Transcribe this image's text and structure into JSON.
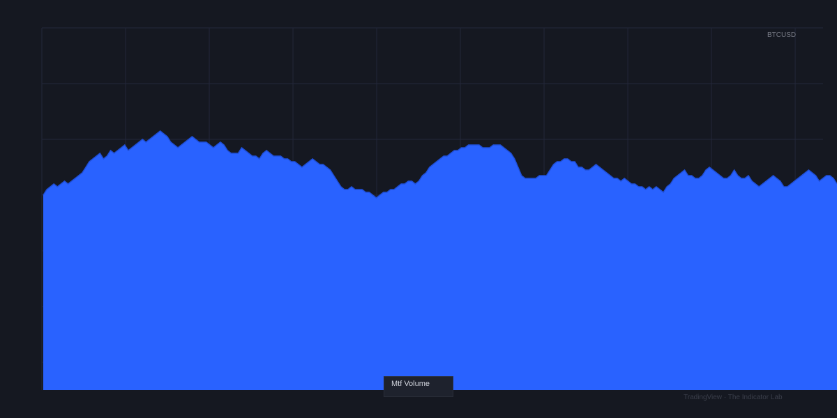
{
  "colors": {
    "background": "#151821",
    "grid": "#23273a",
    "area_fill": "#2962ff",
    "area_stroke": "#1f4fd8"
  },
  "symbol": "BTCUSD",
  "indicator_label": "Mtf Volume",
  "watermark": "TradingView · The Indicator Lab",
  "chart_data": {
    "type": "area",
    "grid": true,
    "legend": "none",
    "ylim": [
      0,
      130
    ],
    "x": [
      0,
      1,
      2,
      3,
      4,
      5,
      6,
      7,
      8,
      9,
      10,
      11,
      12,
      13,
      14,
      15,
      16,
      17,
      18,
      19,
      20,
      21,
      22,
      23,
      24,
      25,
      26,
      27,
      28,
      29,
      30,
      31,
      32,
      33,
      34,
      35,
      36,
      37,
      38,
      39,
      40,
      41,
      42,
      43,
      44,
      45,
      46,
      47,
      48,
      49,
      50,
      51,
      52,
      53,
      54,
      55,
      56,
      57,
      58,
      59,
      60,
      61,
      62,
      63,
      64,
      65,
      66,
      67,
      68,
      69,
      70,
      71,
      72,
      73,
      74,
      75,
      76,
      77,
      78,
      79,
      80,
      81,
      82,
      83,
      84,
      85,
      86,
      87,
      88,
      89,
      90,
      91,
      92,
      93,
      94,
      95,
      96,
      97,
      98,
      99,
      100,
      101,
      102,
      103,
      104,
      105,
      106,
      107,
      108,
      109,
      110,
      111,
      112,
      113,
      114,
      115,
      116,
      117,
      118,
      119,
      120,
      121,
      122,
      123,
      124,
      125,
      126,
      127,
      128,
      129,
      130,
      131,
      132,
      133,
      134,
      135,
      136,
      137,
      138,
      139,
      140,
      141,
      142,
      143,
      144,
      145,
      146,
      147,
      148,
      149,
      150,
      151,
      152,
      153,
      154,
      155,
      156,
      157,
      158,
      159,
      160,
      161,
      162,
      163,
      164,
      165,
      166,
      167,
      168,
      169,
      170,
      171,
      172,
      173,
      174,
      175,
      176,
      177,
      178,
      179,
      180,
      181,
      182,
      183,
      184,
      185,
      186,
      187,
      188,
      189,
      190,
      191,
      192,
      193,
      194,
      195,
      196,
      197,
      198,
      199,
      200,
      201,
      202,
      203,
      204,
      205,
      206,
      207,
      208,
      209,
      210,
      211,
      212,
      213,
      214,
      215,
      216,
      217,
      218,
      219,
      220,
      221,
      222,
      223,
      224
    ],
    "values": [
      70,
      72,
      73,
      74,
      73,
      74,
      75,
      74,
      75,
      76,
      77,
      78,
      80,
      82,
      83,
      84,
      85,
      83,
      84,
      86,
      85,
      86,
      87,
      88,
      86,
      87,
      88,
      89,
      90,
      89,
      90,
      91,
      92,
      93,
      92,
      91,
      89,
      88,
      87,
      88,
      89,
      90,
      91,
      90,
      89,
      89,
      89,
      88,
      87,
      88,
      89,
      88,
      86,
      85,
      85,
      85,
      87,
      86,
      85,
      84,
      84,
      83,
      85,
      86,
      85,
      84,
      84,
      84,
      83,
      83,
      82,
      82,
      81,
      80,
      81,
      82,
      83,
      82,
      81,
      81,
      80,
      79,
      77,
      75,
      73,
      72,
      72,
      73,
      72,
      72,
      72,
      71,
      71,
      70,
      69,
      70,
      71,
      71,
      72,
      72,
      73,
      74,
      74,
      75,
      75,
      74,
      75,
      77,
      78,
      80,
      81,
      82,
      83,
      84,
      84,
      85,
      86,
      86,
      87,
      87,
      88,
      88,
      88,
      88,
      87,
      87,
      87,
      88,
      88,
      88,
      87,
      86,
      85,
      83,
      80,
      77,
      76,
      76,
      76,
      76,
      77,
      77,
      77,
      79,
      81,
      82,
      82,
      83,
      83,
      82,
      82,
      80,
      80,
      79,
      79,
      80,
      81,
      80,
      79,
      78,
      77,
      76,
      76,
      75,
      76,
      75,
      74,
      74,
      73,
      73,
      72,
      73,
      72,
      73,
      72,
      71,
      73,
      74,
      76,
      77,
      78,
      79,
      77,
      77,
      76,
      76,
      77,
      79,
      80,
      79,
      78,
      77,
      76,
      76,
      77,
      79,
      77,
      76,
      76,
      77,
      75,
      74,
      73,
      74,
      75,
      76,
      77,
      76,
      75,
      73,
      73,
      74,
      75,
      76,
      77,
      78,
      79,
      78,
      77,
      75,
      76,
      77,
      77,
      76,
      74
    ]
  }
}
